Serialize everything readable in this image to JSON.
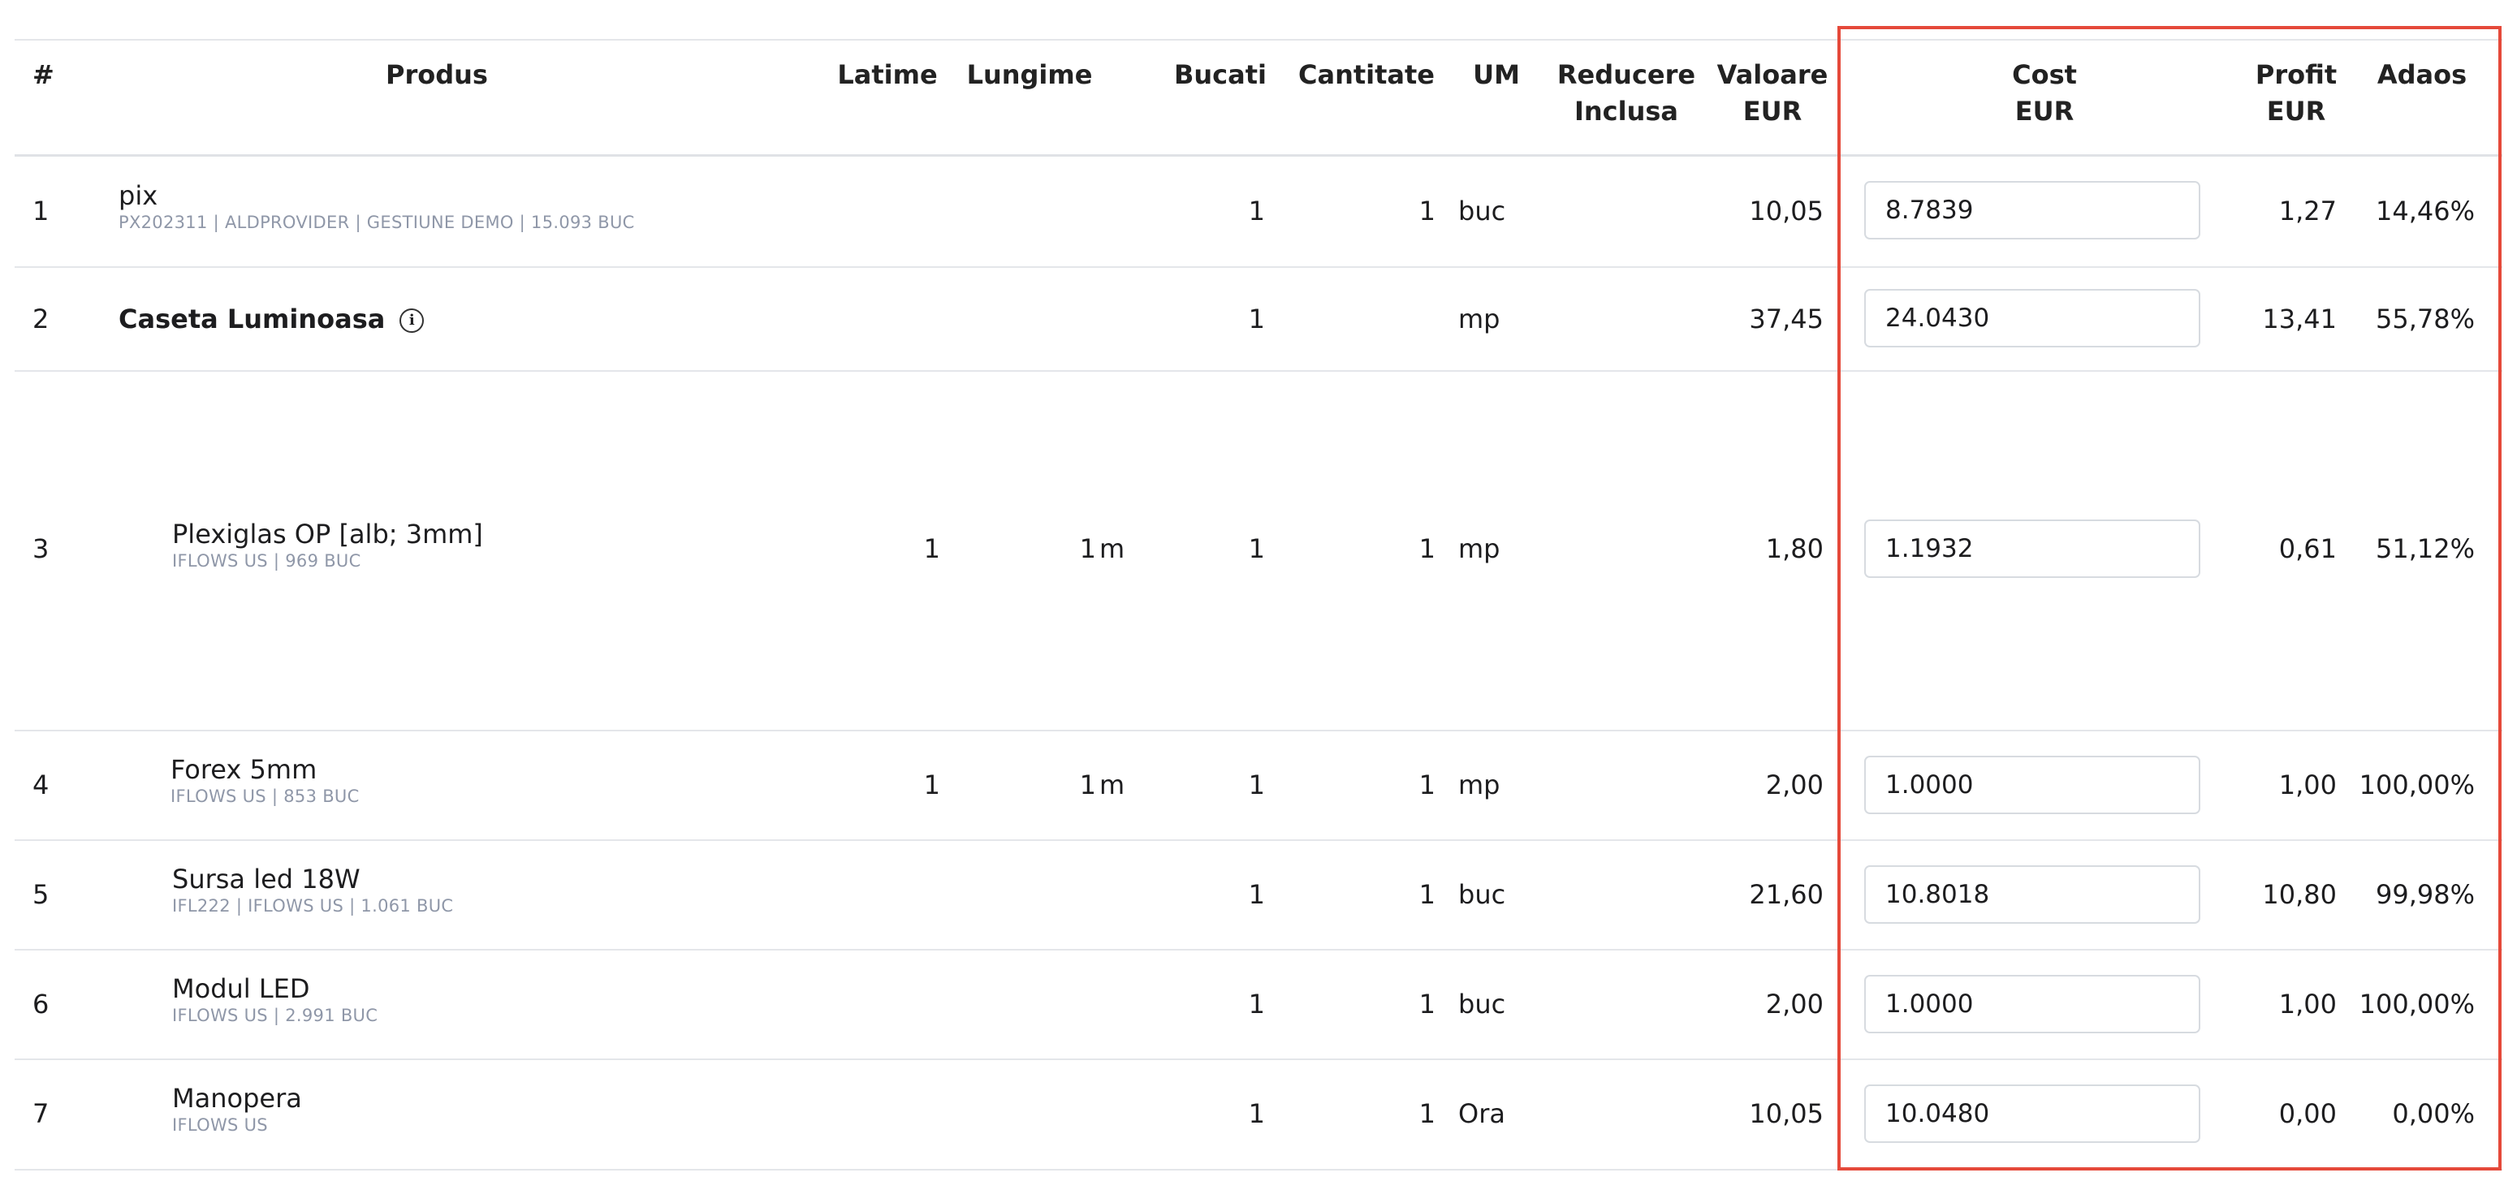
{
  "accent_color": "#e5493a",
  "headers": {
    "index": "#",
    "product": "Produs",
    "width": "Latime",
    "length": "Lungime",
    "pieces": "Bucati",
    "quantity": "Cantitate",
    "um": "UM",
    "discount_line1": "Reducere",
    "discount_line2": "Inclusa",
    "value_line1": "Valoare",
    "value_line2": "EUR",
    "cost_line1": "Cost",
    "cost_line2": "EUR",
    "profit_line1": "Profit",
    "profit_line2": "EUR",
    "margin": "Adaos"
  },
  "rows": [
    {
      "index": "1",
      "name": "pix",
      "sub": "PX202311 | ALDPROVIDER | GESTIUNE DEMO | 15.093 BUC",
      "width": "",
      "length": "",
      "length_unit": "",
      "pieces": "1",
      "quantity": "1",
      "um": "buc",
      "value": "10,05",
      "cost": "8.7839",
      "profit": "1,27",
      "margin": "14,46%"
    },
    {
      "index": "2",
      "name": "Caseta Luminoasa",
      "sub": "",
      "width": "",
      "length": "",
      "length_unit": "",
      "pieces": "1",
      "quantity": "",
      "um": "mp",
      "value": "37,45",
      "cost": "24.0430",
      "profit": "13,41",
      "margin": "55,78%"
    },
    {
      "index": "3",
      "name": "Plexiglas OP [alb; 3mm]",
      "sub": "IFLOWS US | 969 BUC",
      "width": "1",
      "length": "1",
      "length_unit": "m",
      "pieces": "1",
      "quantity": "1",
      "um": "mp",
      "value": "1,80",
      "cost": "1.1932",
      "profit": "0,61",
      "margin": "51,12%"
    },
    {
      "index": "4",
      "name": "Forex 5mm",
      "sub": "IFLOWS US | 853 BUC",
      "width": "1",
      "length": "1",
      "length_unit": "m",
      "pieces": "1",
      "quantity": "1",
      "um": "mp",
      "value": "2,00",
      "cost": "1.0000",
      "profit": "1,00",
      "margin": "100,00%"
    },
    {
      "index": "5",
      "name": "Sursa led 18W",
      "sub": "IFL222 | IFLOWS US | 1.061 BUC",
      "width": "",
      "length": "",
      "length_unit": "",
      "pieces": "1",
      "quantity": "1",
      "um": "buc",
      "value": "21,60",
      "cost": "10.8018",
      "profit": "10,80",
      "margin": "99,98%"
    },
    {
      "index": "6",
      "name": "Modul LED",
      "sub": "IFLOWS US | 2.991 BUC",
      "width": "",
      "length": "",
      "length_unit": "",
      "pieces": "1",
      "quantity": "1",
      "um": "buc",
      "value": "2,00",
      "cost": "1.0000",
      "profit": "1,00",
      "margin": "100,00%"
    },
    {
      "index": "7",
      "name": "Manopera",
      "sub": "IFLOWS US",
      "width": "",
      "length": "",
      "length_unit": "",
      "pieces": "1",
      "quantity": "1",
      "um": "Ora",
      "value": "10,05",
      "cost": "10.0480",
      "profit": "0,00",
      "margin": "0,00%"
    }
  ]
}
